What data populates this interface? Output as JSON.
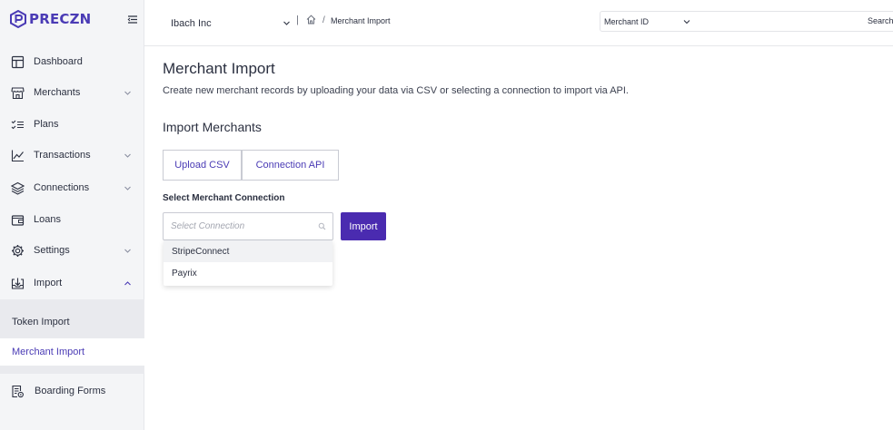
{
  "brand": {
    "name": "PRECZN",
    "accent": "#4a3bb5",
    "button": "#4a2bb0"
  },
  "sidebar": {
    "items": [
      {
        "label": "Dashboard",
        "icon": "dashboard-icon",
        "chevron": ""
      },
      {
        "label": "Merchants",
        "icon": "store-icon",
        "chevron": "down"
      },
      {
        "label": "Plans",
        "icon": "checklist-icon",
        "chevron": ""
      },
      {
        "label": "Transactions",
        "icon": "chart-line-icon",
        "chevron": "down"
      },
      {
        "label": "Connections",
        "icon": "layers-icon",
        "chevron": "down"
      },
      {
        "label": "Loans",
        "icon": "wallet-icon",
        "chevron": ""
      },
      {
        "label": "Settings",
        "icon": "gear-icon",
        "chevron": "down"
      },
      {
        "label": "Import",
        "icon": "import-icon",
        "chevron": "up"
      }
    ],
    "submenu": [
      {
        "label": "Token Import",
        "active": false
      },
      {
        "label": "Merchant Import",
        "active": true
      }
    ],
    "footer_item": {
      "label": "Boarding Forms",
      "icon": "forms-icon"
    }
  },
  "header": {
    "company": "Ibach Inc",
    "separator": "|",
    "breadcrumb": {
      "slash": "/",
      "current": "Merchant Import"
    },
    "search": {
      "field": "Merchant ID",
      "button": "Search",
      "placeholder": ""
    }
  },
  "main": {
    "title": "Merchant Import",
    "description": "Create new merchant records by uploading your data via CSV or selecting a connection to import via API.",
    "section_title": "Import Merchants",
    "tabs": [
      "Upload CSV",
      "Connection API"
    ],
    "field_label": "Select Merchant Connection",
    "select_placeholder": "Select Connection",
    "import_button": "Import",
    "dropdown_options": [
      "StripeConnect",
      "Payrix"
    ]
  }
}
